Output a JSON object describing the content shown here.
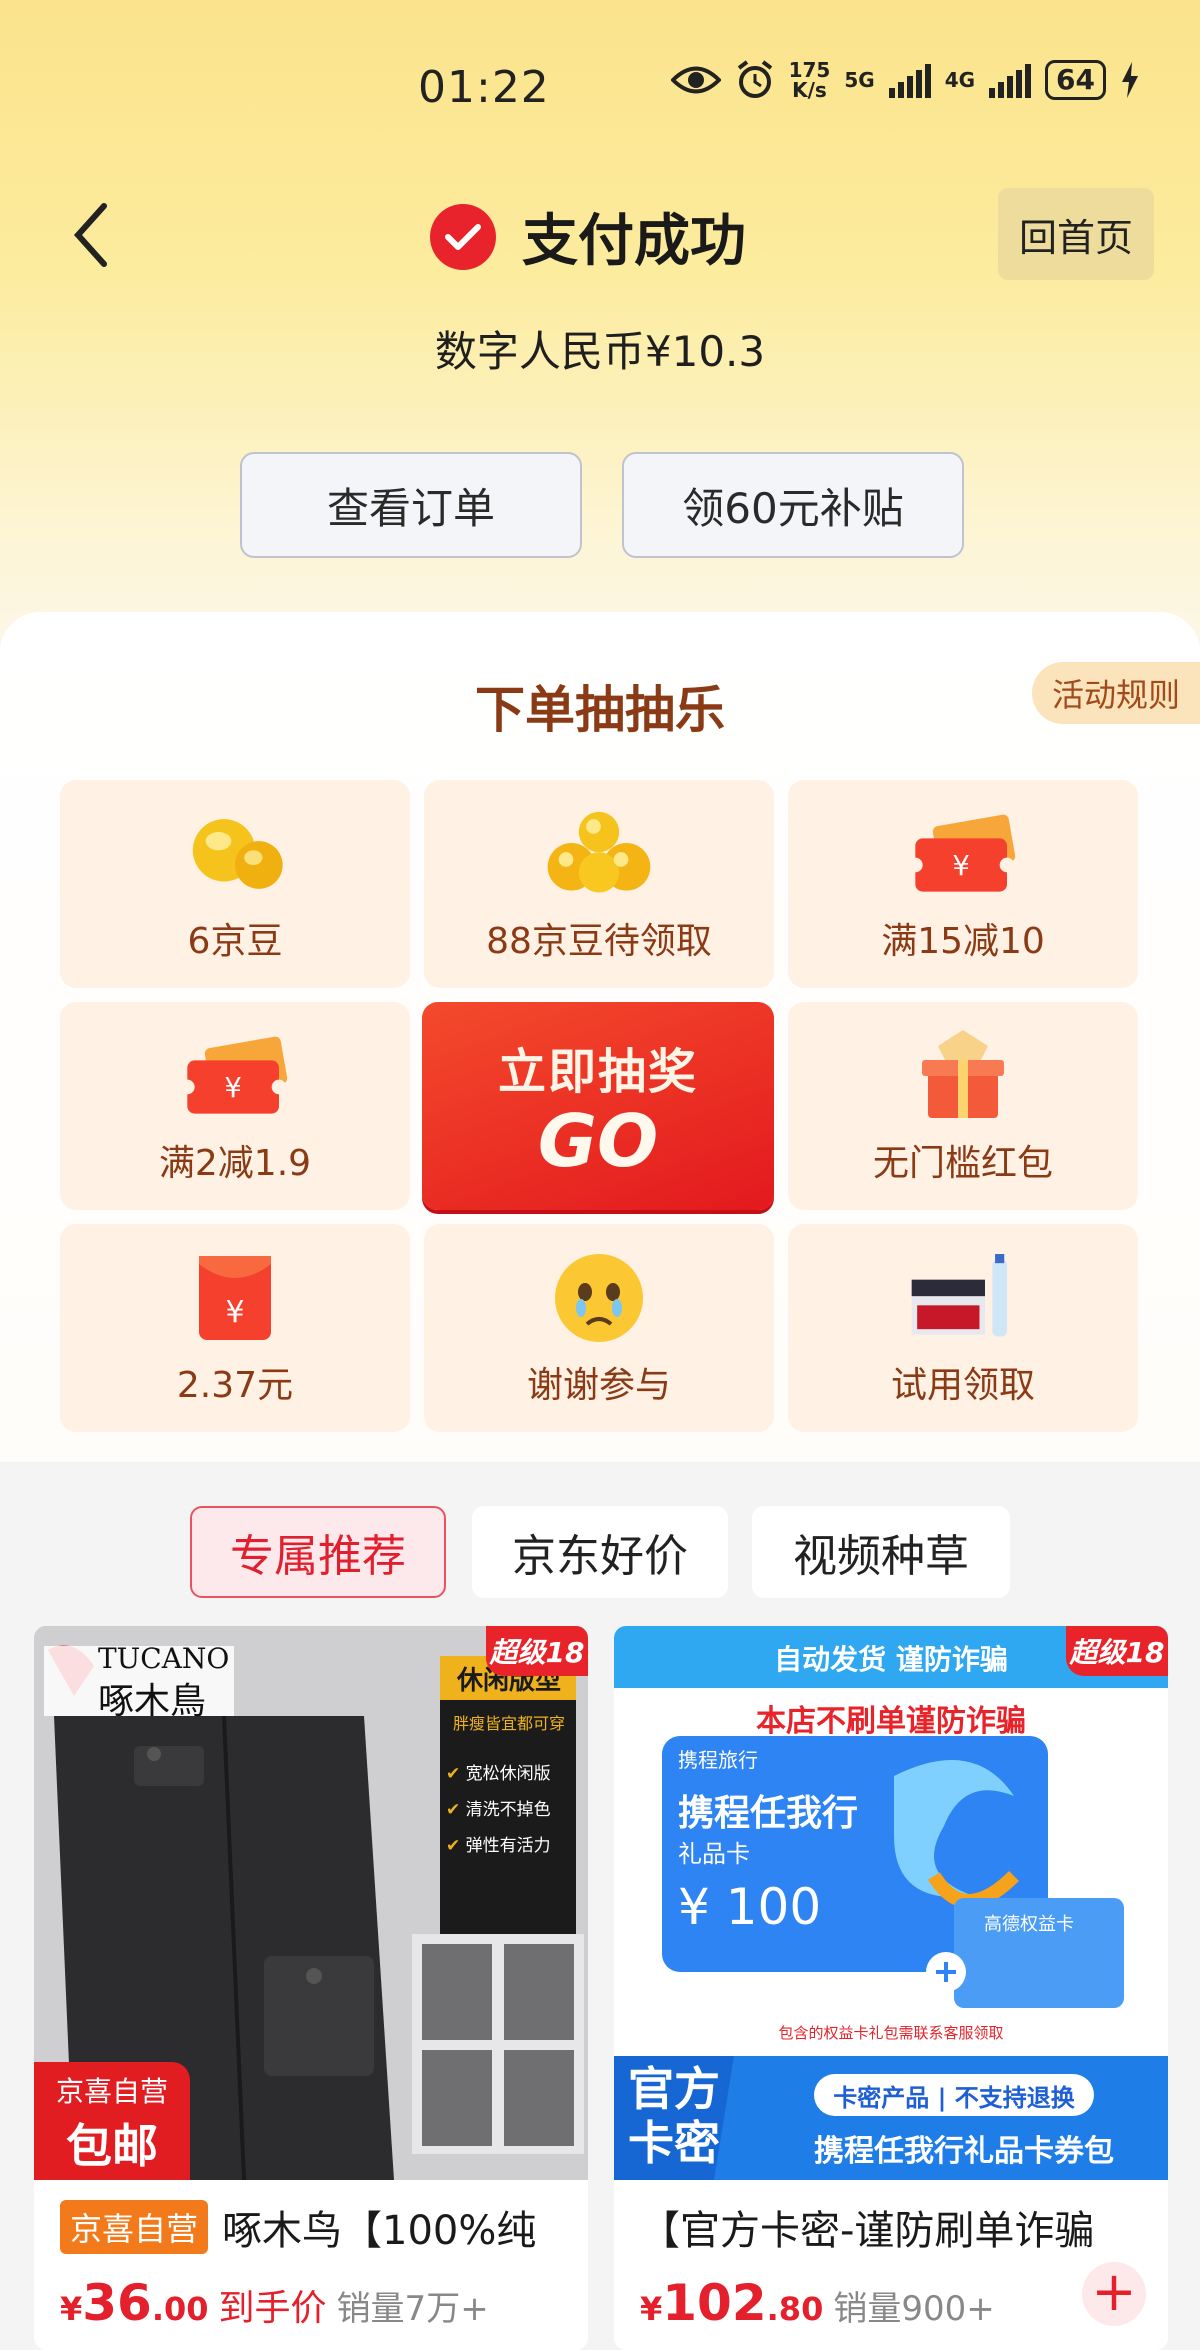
{
  "status_bar": {
    "time": "01:22",
    "speed_top": "175",
    "speed_bottom": "K/s",
    "net1": "5G",
    "net2": "4G",
    "battery": "64",
    "icons": [
      "eye-icon",
      "alarm-icon",
      "signal-icon",
      "battery-icon",
      "charging-icon"
    ]
  },
  "header": {
    "back_icon": "chevron-left-icon",
    "title": "支付成功",
    "home_button": "回首页",
    "amount": "数字人民币¥10.3",
    "buttons": {
      "view_order": "查看订单",
      "subsidy": "领60元补贴"
    }
  },
  "lottery": {
    "title": "下单抽抽乐",
    "rules": "活动规则",
    "prizes": [
      {
        "label": "6京豆",
        "icon": "bean-icon"
      },
      {
        "label": "88京豆待领取",
        "icon": "beans-pile-icon"
      },
      {
        "label": "满15减10",
        "icon": "coupon-icon"
      },
      {
        "label": "满2减1.9",
        "icon": "coupon-icon"
      },
      {
        "label": "无门槛红包",
        "icon": "gift-box-icon"
      },
      {
        "label": "2.37元",
        "icon": "red-envelope-icon"
      },
      {
        "label": "谢谢参与",
        "icon": "crying-face-icon"
      },
      {
        "label": "试用领取",
        "icon": "product-box-icon"
      }
    ],
    "go": {
      "label": "立即抽奖",
      "big": "GO"
    }
  },
  "tabs": [
    {
      "label": "专属推荐",
      "active": true
    },
    {
      "label": "京东好价",
      "active": false
    },
    {
      "label": "视频种草",
      "active": false
    }
  ],
  "products": [
    {
      "badge": "超级18",
      "brand_en": "TUCANO",
      "brand_cn": "啄木鳥",
      "side_title": "休闲版型",
      "side_sub": "胖瘦皆宜都可穿",
      "features": [
        "宽松休闲版",
        "清洗不掉色",
        "弹性有活力"
      ],
      "ship_tag_1": "京喜自营",
      "ship_tag_2": "包邮",
      "tag": "京喜自营",
      "name": "啄木鸟【100%纯",
      "price_currency": "¥",
      "price_int": "36",
      "price_dec": ".00",
      "price_note": "到手价",
      "sales": "销量7万+"
    },
    {
      "badge": "超级18",
      "banner_top": "自动发货  谨防诈骗",
      "banner_warn": "本店不刷单谨防诈骗",
      "card_brand": "携程旅行",
      "card_title": "携程任我行",
      "card_sub": "礼品卡",
      "card_value": "¥ 100",
      "card_small": "高德权益卡",
      "card_note": "包含的权益卡礼包需联系客服领取",
      "official_1": "官方",
      "official_2": "卡密",
      "pill": "卡密产品 | 不支持退换",
      "bottom_title": "携程任我行礼品卡券包",
      "name": "【官方卡密-谨防刷单诈骗",
      "price_currency": "¥",
      "price_int": "102",
      "price_dec": ".80",
      "sales": "销量900+"
    }
  ],
  "colors": {
    "accent_red": "#e3202b",
    "header_gradient_top": "#fbe38c",
    "lottery_text": "#8a3b16",
    "prize_bg": "#fff1e4"
  }
}
